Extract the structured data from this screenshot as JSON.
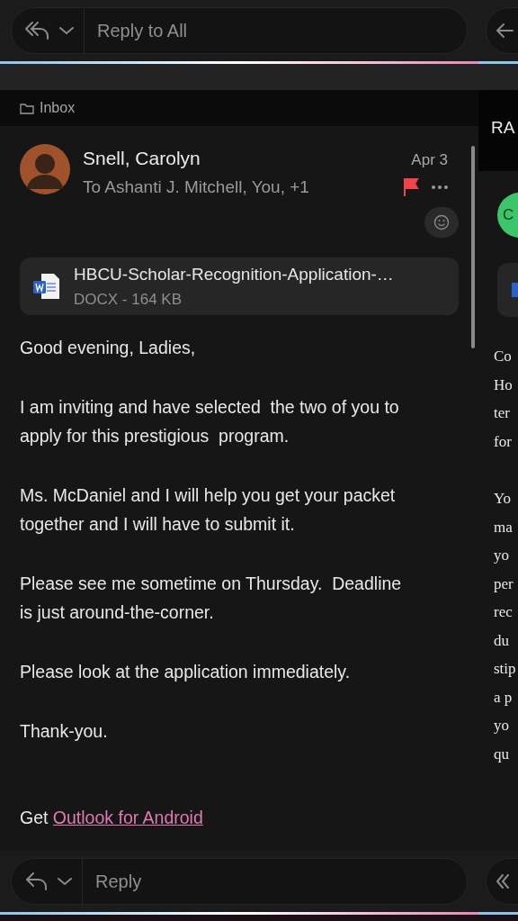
{
  "top_reply": {
    "label": "Reply to All"
  },
  "folder": "Inbox",
  "message": {
    "sender": "Snell, Carolyn",
    "recipients": "To Ashanti J. Mitchell, You, +1",
    "date": "Apr 3",
    "flagged": true,
    "attachment": {
      "name": "HBCU-Scholar-Recognition-Application-…",
      "info": "DOCX - 164 KB"
    },
    "paragraphs": [
      [
        "Good evening, Ladies,"
      ],
      [
        "I am inviting and have selected  the two of you to",
        "apply for this prestigious  program."
      ],
      [
        "Ms. McDaniel and I will help you get your packet",
        "together and I will have to submit it."
      ],
      [
        "Please see me sometime on Thursday.  Deadline",
        "is just around-the-corner."
      ],
      [
        "Please look at the application immediately."
      ],
      [
        "Thank-you."
      ]
    ],
    "signature_prefix": "Get ",
    "signature_link": "Outlook for Android"
  },
  "next_message": {
    "title": "RA",
    "avatar": "C",
    "paragraphs": [
      [
        "Co",
        "Ho",
        "ter",
        "for"
      ],
      [
        "Yo",
        "ma",
        "yo",
        "per",
        "rec",
        "du",
        "stip",
        "a p",
        "yo",
        "qu"
      ]
    ]
  },
  "bottom_reply": {
    "label": "Reply"
  }
}
